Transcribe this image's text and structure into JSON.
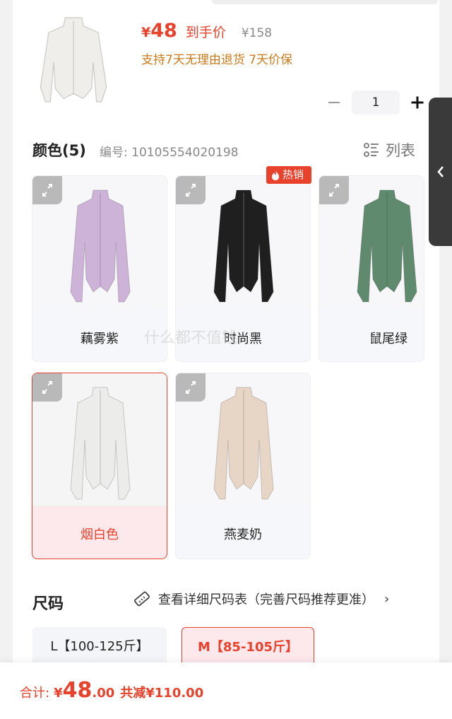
{
  "product": {
    "price_symbol": "¥",
    "price_value": "48",
    "price_tag": "到手价",
    "original_price": "¥158",
    "promise": "支持7天无理由退货 7天价保"
  },
  "quantity": {
    "value": "1"
  },
  "color": {
    "title": "颜色(5)",
    "code": "编号: 10105554020198",
    "list_label": "列表",
    "hot_badge": "热销",
    "options": [
      {
        "name": "藕雾紫",
        "color": "#cdb3d8"
      },
      {
        "name": "时尚黑",
        "color": "#1f1f1f"
      },
      {
        "name": "鼠尾绿",
        "color": "#5f8a6e"
      },
      {
        "name": "烟白色",
        "color": "#ececea",
        "selected": true
      },
      {
        "name": "燕麦奶",
        "color": "#e7d6c6"
      }
    ],
    "watermark": "什么都不值钱"
  },
  "size": {
    "title": "尺码",
    "chart_link": "查看详细尺码表（完善尺码推荐更准）",
    "chevron": "›",
    "options": [
      {
        "label": "L【100-125斤】"
      },
      {
        "label": "M【85-105斤】",
        "selected": true
      }
    ]
  },
  "footer": {
    "total_label": "合计:",
    "total_symbol": "¥",
    "total_int": "48",
    "total_dec": ".00",
    "saved": "共减¥110.00"
  },
  "colors": {
    "accent": "#e8412c",
    "promise": "#c97a1c"
  }
}
